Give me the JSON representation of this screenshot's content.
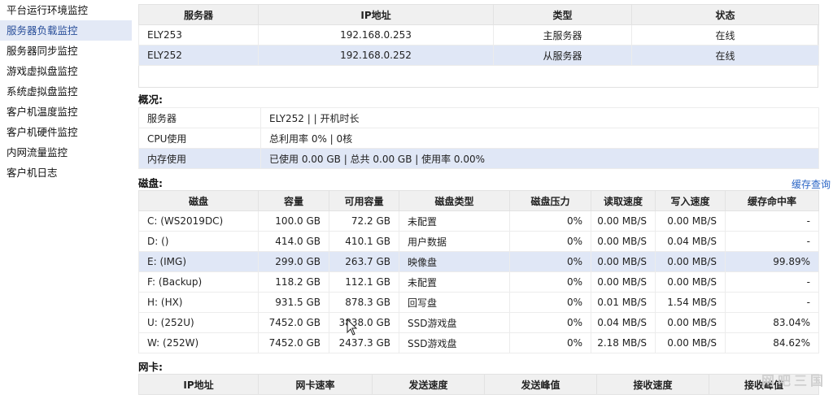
{
  "sidebar": {
    "items": [
      {
        "label": "平台运行环境监控",
        "active": false
      },
      {
        "label": "服务器负载监控",
        "active": true
      },
      {
        "label": "服务器同步监控",
        "active": false
      },
      {
        "label": "游戏虚拟盘监控",
        "active": false
      },
      {
        "label": "系统虚拟盘监控",
        "active": false
      },
      {
        "label": "客户机温度监控",
        "active": false
      },
      {
        "label": "客户机硬件监控",
        "active": false
      },
      {
        "label": "内网流量监控",
        "active": false
      },
      {
        "label": "客户机日志",
        "active": false
      }
    ]
  },
  "servers": {
    "headers": [
      "服务器",
      "IP地址",
      "类型",
      "状态"
    ],
    "rows": [
      {
        "name": "ELY253",
        "ip": "192.168.0.253",
        "type": "主服务器",
        "status": "在线"
      },
      {
        "name": "ELY252",
        "ip": "192.168.0.252",
        "type": "从服务器",
        "status": "在线"
      }
    ]
  },
  "overview": {
    "title": "概况:",
    "rows": [
      {
        "label": "服务器",
        "value": "ELY252 |  | 开机时长"
      },
      {
        "label": "CPU使用",
        "value": "总利用率 0% | 0核"
      },
      {
        "label": "内存使用",
        "value": "已使用 0.00 GB | 总共 0.00 GB | 使用率 0.00%"
      }
    ]
  },
  "disks": {
    "title": "磁盘:",
    "cache_link": "缓存查询",
    "headers": [
      "磁盘",
      "容量",
      "可用容量",
      "磁盘类型",
      "磁盘压力",
      "读取速度",
      "写入速度",
      "缓存命中率"
    ],
    "rows": [
      {
        "disk": "C: (WS2019DC)",
        "capacity": "100.0 GB",
        "free": "72.2 GB",
        "type": "未配置",
        "pressure": "0%",
        "read": "0.00 MB/S",
        "write": "0.00 MB/S",
        "hit": "-"
      },
      {
        "disk": "D: ()",
        "capacity": "414.0 GB",
        "free": "410.1 GB",
        "type": "用户数据",
        "pressure": "0%",
        "read": "0.00 MB/S",
        "write": "0.04 MB/S",
        "hit": "-"
      },
      {
        "disk": "E: (IMG)",
        "capacity": "299.0 GB",
        "free": "263.7 GB",
        "type": "映像盘",
        "pressure": "0%",
        "read": "0.00 MB/S",
        "write": "0.00 MB/S",
        "hit": "99.89%"
      },
      {
        "disk": "F: (Backup)",
        "capacity": "118.2 GB",
        "free": "112.1 GB",
        "type": "未配置",
        "pressure": "0%",
        "read": "0.00 MB/S",
        "write": "0.00 MB/S",
        "hit": "-"
      },
      {
        "disk": "H: (HX)",
        "capacity": "931.5 GB",
        "free": "878.3 GB",
        "type": "回写盘",
        "pressure": "0%",
        "read": "0.01 MB/S",
        "write": "1.54 MB/S",
        "hit": "-"
      },
      {
        "disk": "U: (252U)",
        "capacity": "7452.0 GB",
        "free": "3838.0 GB",
        "type": "SSD游戏盘",
        "pressure": "0%",
        "read": "0.04 MB/S",
        "write": "0.00 MB/S",
        "hit": "83.04%"
      },
      {
        "disk": "W: (252W)",
        "capacity": "7452.0 GB",
        "free": "2437.3 GB",
        "type": "SSD游戏盘",
        "pressure": "0%",
        "read": "2.18 MB/S",
        "write": "0.00 MB/S",
        "hit": "84.62%"
      }
    ]
  },
  "nic": {
    "title": "网卡:",
    "headers": [
      "IP地址",
      "网卡速率",
      "发送速度",
      "发送峰值",
      "接收速度",
      "接收峰值"
    ]
  },
  "watermark": "网吧三国"
}
